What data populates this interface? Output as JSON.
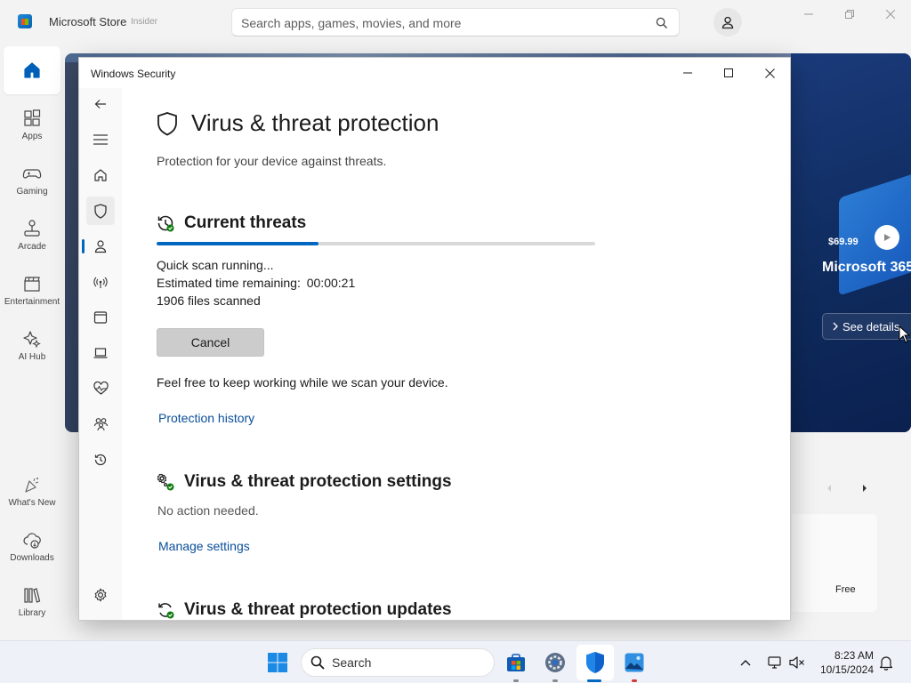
{
  "store": {
    "app_name": "Microsoft Store",
    "badge": "Insider",
    "search_placeholder": "Search apps, games, movies, and more",
    "nav": [
      {
        "label": ""
      },
      {
        "label": "Apps"
      },
      {
        "label": "Gaming"
      },
      {
        "label": "Arcade"
      },
      {
        "label": "Entertainment"
      },
      {
        "label": "AI Hub"
      },
      {
        "label": "What's New"
      },
      {
        "label": "Downloads"
      },
      {
        "label": "Library"
      }
    ],
    "hero": {
      "price": "$69.99",
      "product": "Microsoft 365",
      "cta": "See details"
    },
    "card_price": "Free"
  },
  "security": {
    "window_title": "Windows Security",
    "page_title": "Virus & threat protection",
    "page_subtitle": "Protection for your device against threats.",
    "current_threats": {
      "heading": "Current threats",
      "progress_fraction": 0.37,
      "status": "Quick scan running...",
      "time_label": "Estimated time remaining:",
      "time_value": "00:00:21",
      "files_scanned": "1906 files scanned",
      "cancel_label": "Cancel",
      "note": "Feel free to keep working while we scan your device.",
      "history_link": "Protection history"
    },
    "settings": {
      "heading": "Virus & threat protection settings",
      "status": "No action needed.",
      "manage_link": "Manage settings"
    },
    "updates": {
      "heading": "Virus & threat protection updates"
    },
    "accent": "#0067c0"
  },
  "taskbar": {
    "search_label": "Search",
    "time": "8:23 AM",
    "date": "10/15/2024"
  }
}
